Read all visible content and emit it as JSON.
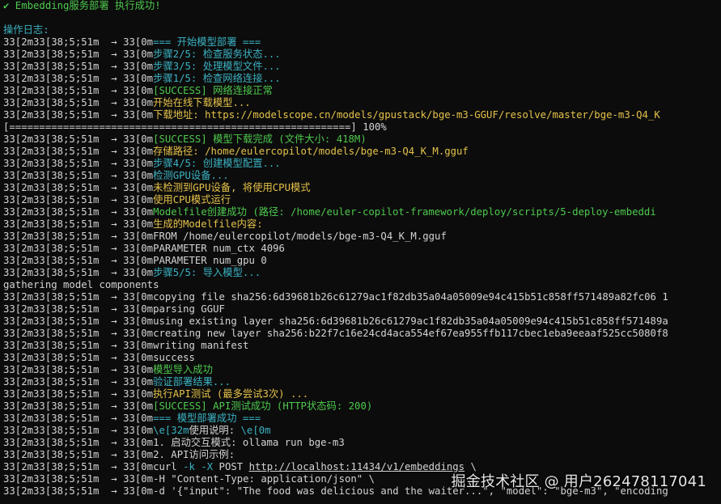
{
  "colors": {
    "background": "#0c0c0c",
    "default": "#d4d4d4",
    "green": "#4ec94e",
    "cyan": "#3bb3c3",
    "yellow": "#e5c24a",
    "link": "#d4d4d4"
  },
  "terminal": {
    "lines": [
      {
        "segments": [
          {
            "text": "✔ Embedding服务部署 执行成功!",
            "color": "green"
          }
        ]
      },
      {
        "segments": [
          {
            "text": "",
            "color": "default"
          }
        ]
      },
      {
        "segments": [
          {
            "text": "操作日志:",
            "color": "cyan"
          }
        ]
      },
      {
        "segments": [
          {
            "text": "33[2m33[38;5;51m  → 33[0m",
            "color": "default"
          },
          {
            "text": "=== 开始模型部署 ===",
            "color": "cyan"
          }
        ]
      },
      {
        "segments": [
          {
            "text": "33[2m33[38;5;51m  → 33[0m",
            "color": "default"
          },
          {
            "text": "步骤2/5: 检查服务状态...",
            "color": "cyan"
          }
        ]
      },
      {
        "segments": [
          {
            "text": "33[2m33[38;5;51m  → 33[0m",
            "color": "default"
          },
          {
            "text": "步骤3/5: 处理模型文件...",
            "color": "cyan"
          }
        ]
      },
      {
        "segments": [
          {
            "text": "33[2m33[38;5;51m  → 33[0m",
            "color": "default"
          },
          {
            "text": "步骤1/5: 检查网络连接...",
            "color": "cyan"
          }
        ]
      },
      {
        "segments": [
          {
            "text": "33[2m33[38;5;51m  → 33[0m",
            "color": "default"
          },
          {
            "text": "[SUCCESS] 网络连接正常",
            "color": "green"
          }
        ]
      },
      {
        "segments": [
          {
            "text": "33[2m33[38;5;51m  → 33[0m",
            "color": "default"
          },
          {
            "text": "开始在线下载模型...",
            "color": "yellow"
          }
        ]
      },
      {
        "segments": [
          {
            "text": "33[2m33[38;5;51m  → 33[0m",
            "color": "default"
          },
          {
            "text": "下载地址: https://modelscope.cn/models/gpustack/bge-m3-GGUF/resolve/master/bge-m3-Q4_K",
            "color": "yellow"
          }
        ]
      },
      {
        "segments": [
          {
            "text": "[=========================================================] 100%",
            "color": "default"
          }
        ]
      },
      {
        "segments": [
          {
            "text": "33[2m33[38;5;51m  → 33[0m",
            "color": "default"
          },
          {
            "text": "[SUCCESS] 模型下载完成 (文件大小: 418M)",
            "color": "green"
          }
        ]
      },
      {
        "segments": [
          {
            "text": "33[2m33[38;5;51m  → 33[0m",
            "color": "default"
          },
          {
            "text": "存储路径: /home/eulercopilot/models/bge-m3-Q4_K_M.gguf",
            "color": "yellow"
          }
        ]
      },
      {
        "segments": [
          {
            "text": "33[2m33[38;5;51m  → 33[0m",
            "color": "default"
          },
          {
            "text": "步骤4/5: 创建模型配置...",
            "color": "cyan"
          }
        ]
      },
      {
        "segments": [
          {
            "text": "33[2m33[38;5;51m  → 33[0m",
            "color": "default"
          },
          {
            "text": "检测GPU设备...",
            "color": "cyan"
          }
        ]
      },
      {
        "segments": [
          {
            "text": "33[2m33[38;5;51m  → 33[0m",
            "color": "default"
          },
          {
            "text": "未检测到GPU设备, 将使用CPU模式",
            "color": "yellow"
          }
        ]
      },
      {
        "segments": [
          {
            "text": "33[2m33[38;5;51m  → 33[0m",
            "color": "default"
          },
          {
            "text": "使用CPU模式运行",
            "color": "yellow"
          }
        ]
      },
      {
        "segments": [
          {
            "text": "33[2m33[38;5;51m  → 33[0m",
            "color": "default"
          },
          {
            "text": "Modelfile创建成功 (路径: /home/euler-copilot-framework/deploy/scripts/5-deploy-embeddi",
            "color": "green"
          }
        ]
      },
      {
        "segments": [
          {
            "text": "33[2m33[38;5;51m  → 33[0m",
            "color": "default"
          },
          {
            "text": "生成的Modelfile内容:",
            "color": "yellow"
          }
        ]
      },
      {
        "segments": [
          {
            "text": "33[2m33[38;5;51m  → 33[0mFROM /home/eulercopilot/models/bge-m3-Q4_K_M.gguf",
            "color": "default"
          }
        ]
      },
      {
        "segments": [
          {
            "text": "33[2m33[38;5;51m  → 33[0mPARAMETER num_ctx 4096",
            "color": "default"
          }
        ]
      },
      {
        "segments": [
          {
            "text": "33[2m33[38;5;51m  → 33[0mPARAMETER num_gpu 0",
            "color": "default"
          }
        ]
      },
      {
        "segments": [
          {
            "text": "33[2m33[38;5;51m  → 33[0m",
            "color": "default"
          },
          {
            "text": "步骤5/5: 导入模型...",
            "color": "cyan"
          }
        ]
      },
      {
        "segments": [
          {
            "text": "gathering model components",
            "color": "default"
          }
        ]
      },
      {
        "segments": [
          {
            "text": "33[2m33[38;5;51m  → 33[0mcopying file sha256:6d39681b26c61279ac1f82db35a04a05009e94c415b51c858ff571489a82fc06 1",
            "color": "default"
          }
        ]
      },
      {
        "segments": [
          {
            "text": "33[2m33[38;5;51m  → 33[0mparsing GGUF",
            "color": "default"
          }
        ]
      },
      {
        "segments": [
          {
            "text": "33[2m33[38;5;51m  → 33[0musing existing layer sha256:6d39681b26c61279ac1f82db35a04a05009e94c415b51c858ff571489a",
            "color": "default"
          }
        ]
      },
      {
        "segments": [
          {
            "text": "33[2m33[38;5;51m  → 33[0mcreating new layer sha256:b22f7c16e24cd4aca554ef67ea955ffb117cbec1eba9eeaaf525cc5080f8",
            "color": "default"
          }
        ]
      },
      {
        "segments": [
          {
            "text": "33[2m33[38;5;51m  → 33[0mwriting manifest",
            "color": "default"
          }
        ]
      },
      {
        "segments": [
          {
            "text": "33[2m33[38;5;51m  → 33[0msuccess",
            "color": "default"
          }
        ]
      },
      {
        "segments": [
          {
            "text": "33[2m33[38;5;51m  → 33[0m",
            "color": "default"
          },
          {
            "text": "模型导入成功",
            "color": "green"
          }
        ]
      },
      {
        "segments": [
          {
            "text": "33[2m33[38;5;51m  → 33[0m",
            "color": "default"
          },
          {
            "text": "验证部署结果...",
            "color": "cyan"
          }
        ]
      },
      {
        "segments": [
          {
            "text": "33[2m33[38;5;51m  → 33[0m",
            "color": "default"
          },
          {
            "text": "执行API测试 (最多尝试3次) ...",
            "color": "yellow"
          }
        ]
      },
      {
        "segments": [
          {
            "text": "33[2m33[38;5;51m  → 33[0m",
            "color": "default"
          },
          {
            "text": "[SUCCESS] API测试成功 (HTTP状态码: 200)",
            "color": "green"
          }
        ]
      },
      {
        "segments": [
          {
            "text": "33[2m33[38;5;51m  → 33[0m",
            "color": "default"
          },
          {
            "text": "=== 模型部署成功 ===",
            "color": "cyan"
          }
        ]
      },
      {
        "segments": [
          {
            "text": "33[2m33[38;5;51m  → 33[0m",
            "color": "default"
          },
          {
            "text": "\\e[32m",
            "color": "cyan"
          },
          {
            "text": "使用说明: ",
            "color": "default"
          },
          {
            "text": "\\e[0m",
            "color": "cyan"
          }
        ]
      },
      {
        "segments": [
          {
            "text": "33[2m33[38;5;51m  → 33[0m1. 启动交互模式: ollama run bge-m3",
            "color": "default"
          }
        ]
      },
      {
        "segments": [
          {
            "text": "33[2m33[38;5;51m  → 33[0m2. API访问示例:",
            "color": "default"
          }
        ]
      },
      {
        "segments": [
          {
            "text": "33[2m33[38;5;51m  → 33[0mcurl ",
            "color": "default"
          },
          {
            "text": "-k -X",
            "color": "cyan"
          },
          {
            "text": " POST ",
            "color": "default"
          },
          {
            "text": "http://localhost:11434/v1/embeddings",
            "color": "link",
            "underline": true
          },
          {
            "text": " \\",
            "color": "default"
          }
        ]
      },
      {
        "segments": [
          {
            "text": "33[2m33[38;5;51m  → 33[0m-H \"Content-Type: application/json\" \\",
            "color": "default"
          }
        ]
      },
      {
        "segments": [
          {
            "text": "33[2m33[38;5;51m  → 33[0m-d '{\"input\": \"The food was delicious and the waiter...\", \"model\": \"bge-m3\", \"encoding",
            "color": "default"
          }
        ]
      }
    ]
  },
  "watermark": {
    "text": "掘金技术社区 @ 用户262478117041"
  }
}
